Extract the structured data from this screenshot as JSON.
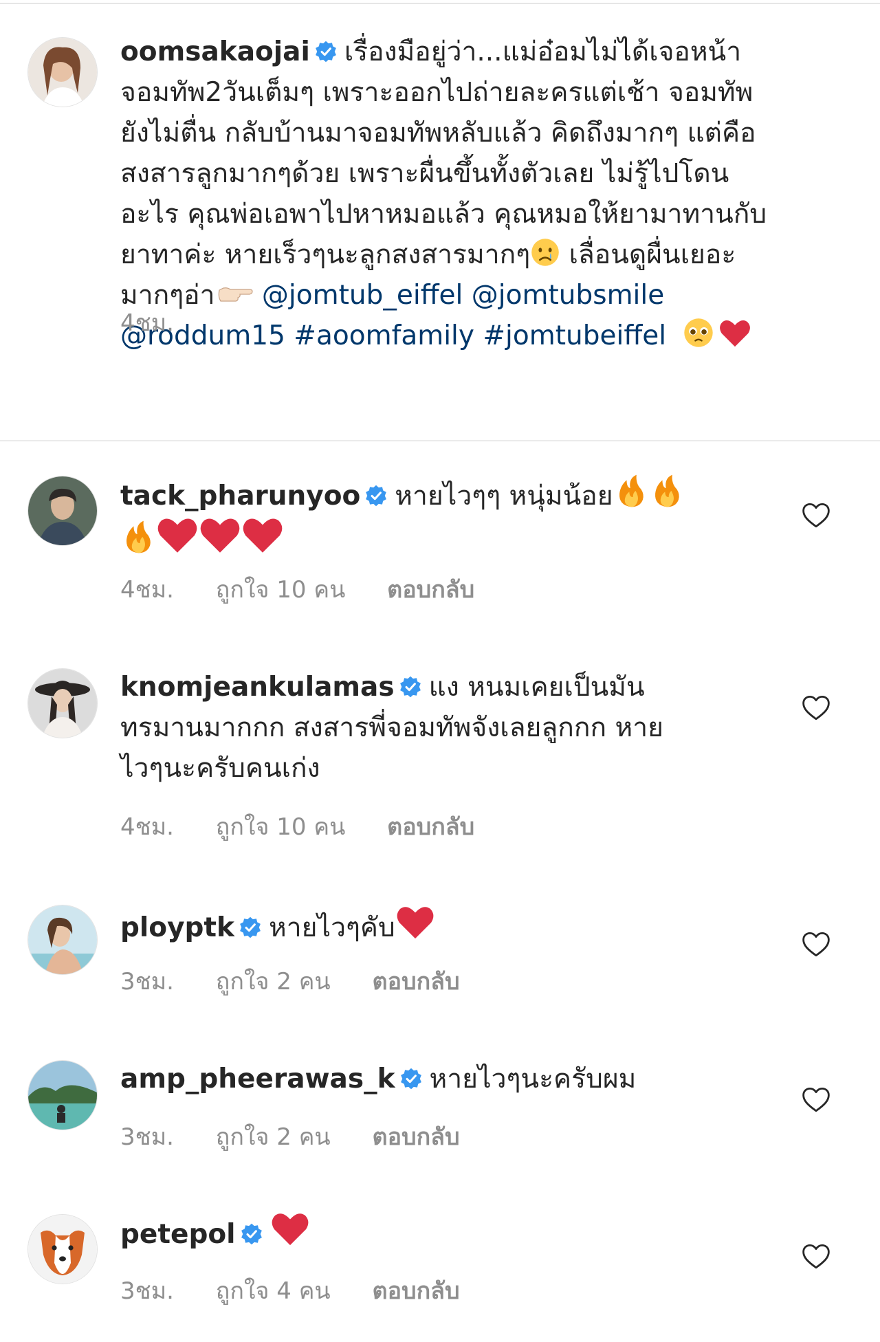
{
  "post": {
    "username": "oomsakaojai",
    "lines": [
      "เรื่องมือยู่ว่า...แม่อ๋อมไม่ได้เจอหน้า",
      "จอมทัพ2วันเต็มๆ เพราะออกไปถ่ายละครแต่เช้า จอมทัพ",
      "ยังไม่ตื่น กลับบ้านมาจอมทัพหลับแล้ว คิดถึงมากๆ แต่คือ",
      "สงสารลูกมากๆด้วย เพราะผื่นขึ้นทั้งตัวเลย ไม่รู้ไปโดน",
      "อะไร คุณพ่อเอพาไปหาหมอแล้ว คุณหมอให้ยามาทานกับ",
      "ยาทาค่ะ หายเร็วๆนะลูกสงสารมากๆ",
      " เลื่อนดูผื่นเยอะ",
      "มากๆอ่า",
      "@jomtub_eiffel",
      "@jomtubsmile",
      "@roddum15",
      "#aoomfamily",
      "#jomtubeiffel"
    ],
    "time": "4ชม."
  },
  "comments": [
    {
      "username": "tack_pharunyoo",
      "text": "หายไวๆๆ หนุ่มน้อย",
      "time": "4ชม.",
      "likes": "ถูกใจ 10 คน",
      "reply": "ตอบกลับ"
    },
    {
      "username": "knomjeankulamas",
      "lines": [
        "แง หนมเคยเป็นมัน",
        "ทรมานมากกก สงสารพี่จอมทัพจังเลยลูกกก หาย",
        "ไวๆนะครับคนเก่ง"
      ],
      "time": "4ชม.",
      "likes": "ถูกใจ 10 คน",
      "reply": "ตอบกลับ"
    },
    {
      "username": "ploypтk",
      "text": "หายไวๆคับ",
      "time": "3ชม.",
      "likes": "ถูกใจ 2 คน",
      "reply": "ตอบกลับ"
    },
    {
      "username": "amp_pheerawas_k",
      "text": "หายไวๆนะครับผม",
      "time": "3ชม.",
      "likes": "ถูกใจ 2 คน",
      "reply": "ตอบกลับ"
    },
    {
      "username": "petepol",
      "text": "",
      "time": "3ชม.",
      "likes": "ถูกใจ 4 คน",
      "reply": "ตอบกลับ"
    }
  ],
  "icons": {
    "verified": "verified-badge-icon",
    "like": "heart-outline-icon",
    "emoji_crying": "crying-face-emoji",
    "emoji_pointing": "pointing-right-emoji",
    "emoji_pleading": "pleading-face-emoji",
    "emoji_heart": "red-heart-emoji",
    "emoji_fire": "fire-emoji"
  },
  "colors": {
    "text": "#262626",
    "meta": "#8e8e8e",
    "mention": "#00376b",
    "verified": "#3897f0",
    "heart": "#ed4956"
  }
}
